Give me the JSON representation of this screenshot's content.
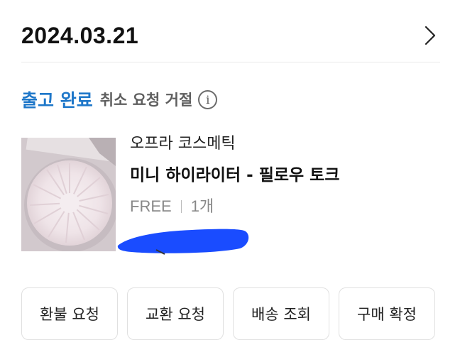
{
  "header": {
    "date": "2024.03.21",
    "chevron_icon": "chevron-right-icon"
  },
  "status": {
    "main_label": "출고 완료",
    "sub_label": "취소 요청 거절",
    "info_icon": "info-icon",
    "main_color": "#1e77c9"
  },
  "product": {
    "thumbnail": "highlighter-product-image",
    "brand": "오프라 코스메틱",
    "name": "미니 하이라이터 - 필로우 토크",
    "option": "FREE",
    "quantity": "1개",
    "price_redacted_color": "#1a4cff"
  },
  "actions": [
    {
      "label": "환불 요청"
    },
    {
      "label": "교환 요청"
    },
    {
      "label": "배송 조회"
    },
    {
      "label": "구매 확정"
    }
  ]
}
